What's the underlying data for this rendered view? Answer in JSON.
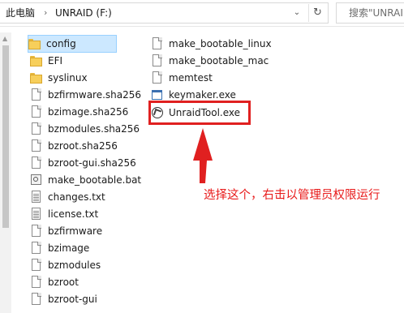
{
  "address_bar": {
    "crumbs": [
      "此电脑",
      "UNRAID (F:)"
    ],
    "search_placeholder": "搜索\"UNRAI"
  },
  "files_left": [
    {
      "name": "config",
      "type": "folder",
      "selected": true
    },
    {
      "name": "EFI",
      "type": "folder"
    },
    {
      "name": "syslinux",
      "type": "folder"
    },
    {
      "name": "bzfirmware.sha256",
      "type": "file"
    },
    {
      "name": "bzimage.sha256",
      "type": "file"
    },
    {
      "name": "bzmodules.sha256",
      "type": "file"
    },
    {
      "name": "bzroot.sha256",
      "type": "file"
    },
    {
      "name": "bzroot-gui.sha256",
      "type": "file"
    },
    {
      "name": "make_bootable.bat",
      "type": "bat"
    },
    {
      "name": "changes.txt",
      "type": "txt"
    },
    {
      "name": "license.txt",
      "type": "txt"
    },
    {
      "name": "bzfirmware",
      "type": "file"
    },
    {
      "name": "bzimage",
      "type": "file"
    },
    {
      "name": "bzmodules",
      "type": "file"
    },
    {
      "name": "bzroot",
      "type": "file"
    },
    {
      "name": "bzroot-gui",
      "type": "file"
    }
  ],
  "files_right": [
    {
      "name": "make_bootable_linux",
      "type": "file"
    },
    {
      "name": "make_bootable_mac",
      "type": "file"
    },
    {
      "name": "memtest",
      "type": "file"
    },
    {
      "name": "keymaker.exe",
      "type": "exe"
    },
    {
      "name": "UnraidTool.exe",
      "type": "tool"
    }
  ],
  "annotation": {
    "text": "选择这个，右击以管理员权限运行",
    "color": "#e81b1b"
  },
  "colors": {
    "selection": "#cce8ff",
    "annotation_red": "#e02020"
  }
}
